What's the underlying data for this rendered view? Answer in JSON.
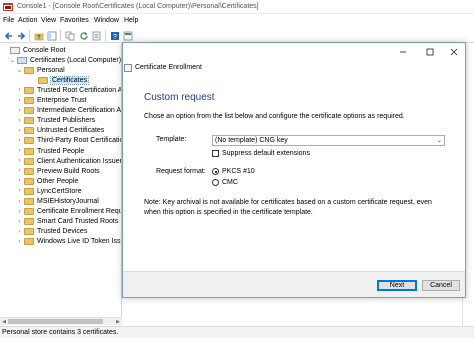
{
  "window": {
    "title": "Console1 - [Console Root\\Certificates (Local Computer)\\Personal\\Certificates]"
  },
  "menu": [
    "File",
    "Action",
    "View",
    "Favorites",
    "Window",
    "Help"
  ],
  "toolbar": {
    "icons": [
      "back-icon",
      "forward-icon",
      "up-folder-icon",
      "show-hide-tree-icon",
      "copy-icon",
      "refresh-icon",
      "export-list-icon",
      "help-icon",
      "properties-icon"
    ]
  },
  "tree": {
    "items": [
      {
        "label": "Console Root",
        "depth": 0,
        "expander": "",
        "icon": "root"
      },
      {
        "label": "Certificates (Local Computer)",
        "depth": 1,
        "expander": "v",
        "icon": "cert"
      },
      {
        "label": "Personal",
        "depth": 2,
        "expander": "v",
        "icon": "folder"
      },
      {
        "label": "Certificates",
        "depth": 3,
        "expander": "",
        "icon": "folder",
        "selected": true
      },
      {
        "label": "Trusted Root Certification Au",
        "depth": 2,
        "expander": ">",
        "icon": "folder"
      },
      {
        "label": "Enterprise Trust",
        "depth": 2,
        "expander": ">",
        "icon": "folder"
      },
      {
        "label": "Intermediate Certification Au",
        "depth": 2,
        "expander": ">",
        "icon": "folder"
      },
      {
        "label": "Trusted Publishers",
        "depth": 2,
        "expander": ">",
        "icon": "folder"
      },
      {
        "label": "Untrusted Certificates",
        "depth": 2,
        "expander": ">",
        "icon": "folder"
      },
      {
        "label": "Third-Party Root Certification",
        "depth": 2,
        "expander": ">",
        "icon": "folder"
      },
      {
        "label": "Trusted People",
        "depth": 2,
        "expander": ">",
        "icon": "folder"
      },
      {
        "label": "Client Authentication Issuers",
        "depth": 2,
        "expander": ">",
        "icon": "folder"
      },
      {
        "label": "Preview Build Roots",
        "depth": 2,
        "expander": ">",
        "icon": "folder"
      },
      {
        "label": "Other People",
        "depth": 2,
        "expander": ">",
        "icon": "folder"
      },
      {
        "label": "LyncCertStore",
        "depth": 2,
        "expander": ">",
        "icon": "folder"
      },
      {
        "label": "MSIEHistoryJournal",
        "depth": 2,
        "expander": ">",
        "icon": "folder"
      },
      {
        "label": "Certificate Enrollment Reques",
        "depth": 2,
        "expander": ">",
        "icon": "folder"
      },
      {
        "label": "Smart Card Trusted Roots",
        "depth": 2,
        "expander": ">",
        "icon": "folder"
      },
      {
        "label": "Trusted Devices",
        "depth": 2,
        "expander": ">",
        "icon": "folder"
      },
      {
        "label": "Windows Live ID Token Issue",
        "depth": 2,
        "expander": ">",
        "icon": "folder"
      }
    ]
  },
  "status": "Personal store contains 3 certificates.",
  "dialog": {
    "window_title": "Certificate Enrollment",
    "heading": "Custom request",
    "intro": "Chose an option from the list below and configure the certificate options as required.",
    "template_label": "Template:",
    "template_value": "(No template) CNG key",
    "suppress_label": "Suppress default extensions",
    "suppress_checked": false,
    "request_format_label": "Request format:",
    "formats": [
      {
        "label": "PKCS #10",
        "selected": true
      },
      {
        "label": "CMC",
        "selected": false
      }
    ],
    "note": "Note: Key archival is not available for certificates based on a custom certificate request, even when this option is specified in the certificate template.",
    "next_label": "Next",
    "cancel_label": "Cancel"
  }
}
